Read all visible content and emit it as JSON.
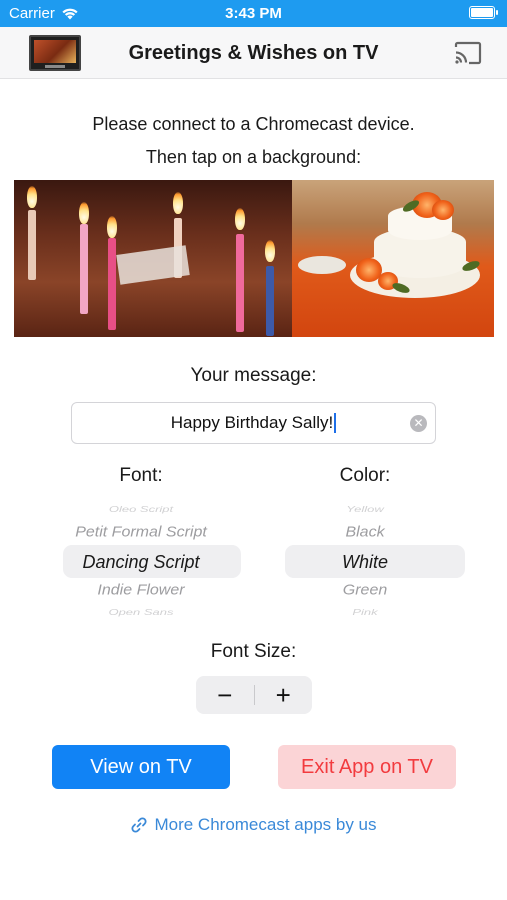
{
  "status_bar": {
    "carrier": "Carrier",
    "time": "3:43 PM"
  },
  "nav": {
    "title": "Greetings & Wishes on TV",
    "logo_icon": "tv-logo-icon",
    "cast_icon": "cast-icon"
  },
  "instructions": {
    "line1": "Please connect to a Chromecast device.",
    "line2": "Then tap on a background:"
  },
  "backgrounds": [
    {
      "name": "birthday-candles"
    },
    {
      "name": "wedding-cake"
    }
  ],
  "message": {
    "label": "Your message:",
    "value": "Happy Birthday Sally!"
  },
  "font_picker": {
    "label": "Font:",
    "options": [
      "Oleo Script",
      "Petit Formal Script",
      "Dancing Script",
      "Indie Flower",
      "Open Sans"
    ],
    "selected": "Dancing Script"
  },
  "color_picker": {
    "label": "Color:",
    "options": [
      "Yellow",
      "Black",
      "White",
      "Green",
      "Pink"
    ],
    "selected": "White"
  },
  "font_size": {
    "label": "Font Size:",
    "decrease": "−",
    "increase": "+"
  },
  "actions": {
    "view": "View on TV",
    "exit": "Exit App on TV"
  },
  "more_link": {
    "label": "More Chromecast apps by us",
    "icon": "link-icon"
  },
  "colors": {
    "status_bar": "#1e9bf0",
    "primary": "#1183f5",
    "exit_bg": "#fbd4d6",
    "exit_text": "#f23b3f",
    "link": "#3a89d8"
  }
}
